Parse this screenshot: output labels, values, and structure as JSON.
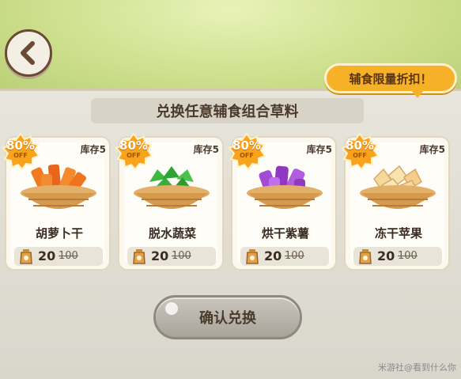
{
  "header": {
    "back_label": ""
  },
  "promo_bubble": "辅食限量折扣！",
  "section_title": "兑换任意辅食组合草料",
  "items": [
    {
      "name": "胡萝卜干",
      "stock": "库存5",
      "discount": "80%",
      "off": "OFF",
      "price": "20",
      "old_price": "100",
      "color": "#f07a1e",
      "icon": "carrot-icon"
    },
    {
      "name": "脱水蔬菜",
      "stock": "库存5",
      "discount": "80%",
      "off": "OFF",
      "price": "20",
      "old_price": "100",
      "color": "#3fb842",
      "icon": "vegetable-icon"
    },
    {
      "name": "烘干紫薯",
      "stock": "库存5",
      "discount": "80%",
      "off": "OFF",
      "price": "20",
      "old_price": "100",
      "color": "#a24bd3",
      "icon": "purple-potato-icon"
    },
    {
      "name": "冻干苹果",
      "stock": "库存5",
      "discount": "80%",
      "off": "OFF",
      "price": "20",
      "old_price": "100",
      "color": "#f5d89a",
      "icon": "apple-icon"
    }
  ],
  "confirm_button": "确认兑换",
  "watermark": "米游社@看到什么你"
}
